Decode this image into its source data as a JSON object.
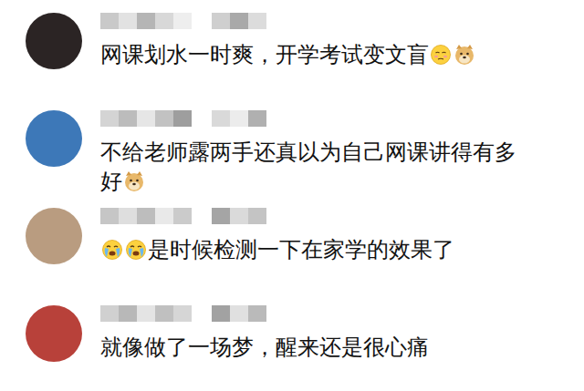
{
  "comments": [
    {
      "text": "网课划水一时爽，开学考试变文盲",
      "icons_before": [],
      "icons_after": [
        {
          "kind": "shy"
        },
        {
          "kind": "doge"
        }
      ]
    },
    {
      "text": "不给老师露两手还真以为自己网课讲得有多好",
      "icons_before": [],
      "icons_after": [
        {
          "kind": "doge"
        }
      ]
    },
    {
      "text": "是时候检测一下在家学的效果了",
      "icons_before": [
        {
          "kind": "crying"
        },
        {
          "kind": "crying"
        }
      ],
      "icons_after": []
    },
    {
      "text": "就像做了一场梦，醒来还是很心痛",
      "icons_before": [],
      "icons_after": []
    }
  ]
}
